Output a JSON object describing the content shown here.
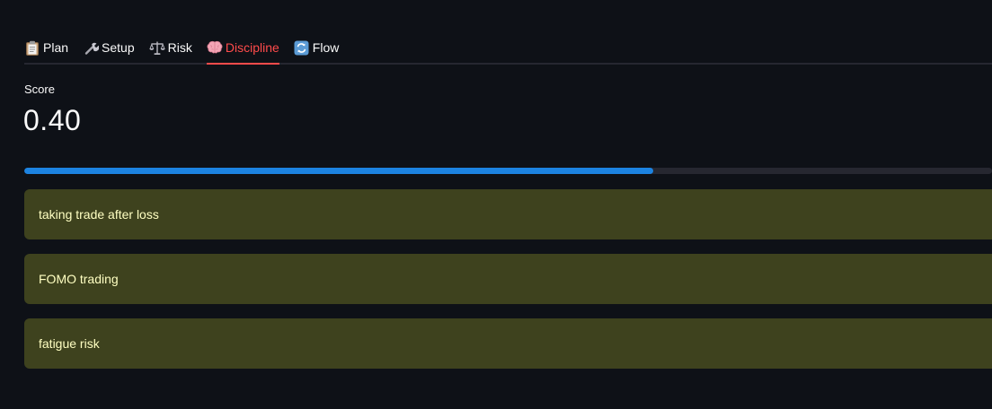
{
  "tabs": [
    {
      "label": "Plan",
      "icon": "clipboard-icon",
      "active": false
    },
    {
      "label": "Setup",
      "icon": "wrench-icon",
      "active": false
    },
    {
      "label": "Risk",
      "icon": "scales-icon",
      "active": false
    },
    {
      "label": "Discipline",
      "icon": "brain-icon",
      "active": true
    },
    {
      "label": "Flow",
      "icon": "cycle-arrows-icon",
      "active": false
    }
  ],
  "metric": {
    "label": "Score",
    "value": "0.40"
  },
  "progress": {
    "fraction": 0.65
  },
  "warnings": [
    {
      "text": "taking trade after loss"
    },
    {
      "text": "FOMO trading"
    },
    {
      "text": "fatigue risk"
    }
  ],
  "colors": {
    "background": "#0e1117",
    "active_tab": "#ff4b4b",
    "progress_fill": "#1c83e1",
    "progress_track": "#262730",
    "warning_bg": "#3e421e",
    "warning_text": "#ffffc2"
  }
}
